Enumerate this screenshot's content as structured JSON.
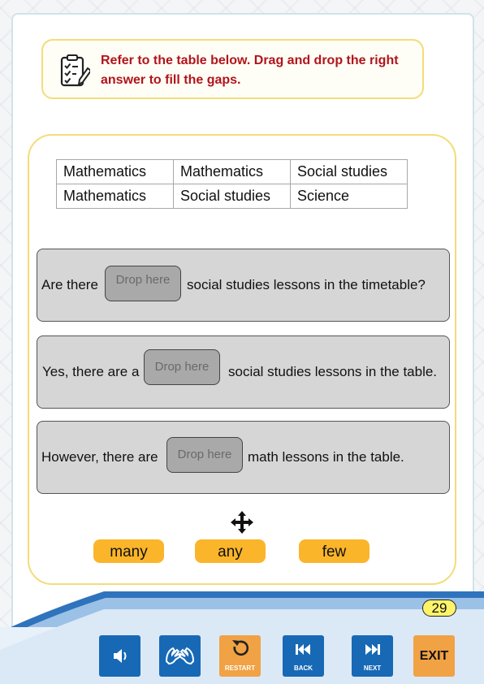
{
  "instruction": {
    "line1": "Refer to the table below. Drag and drop the right",
    "line2": "answer to fill the gaps."
  },
  "table": {
    "rows": [
      [
        "Mathematics",
        "Mathematics",
        "Social studies"
      ],
      [
        "Mathematics",
        "Social studies",
        "Science"
      ]
    ]
  },
  "sentences": [
    {
      "before": "Are there",
      "drop": "Drop here",
      "after": "social studies lessons in the timetable?"
    },
    {
      "before": "Yes, there are a",
      "drop": "Drop here",
      "after": "social studies lessons in the table."
    },
    {
      "before": "However, there are",
      "drop": "Drop here",
      "after": "math lessons in the table."
    }
  ],
  "options": [
    "many",
    "any",
    "few"
  ],
  "page_number": "29",
  "controls": {
    "restart": "RESTART",
    "back": "BACK",
    "next": "NEXT",
    "exit": "EXIT"
  },
  "colors": {
    "instruction_text": "#b1141b",
    "chip": "#fbb52a",
    "nav_blue": "#1769b5",
    "nav_orange": "#f1a244",
    "band_blue": "#2f73bd"
  }
}
